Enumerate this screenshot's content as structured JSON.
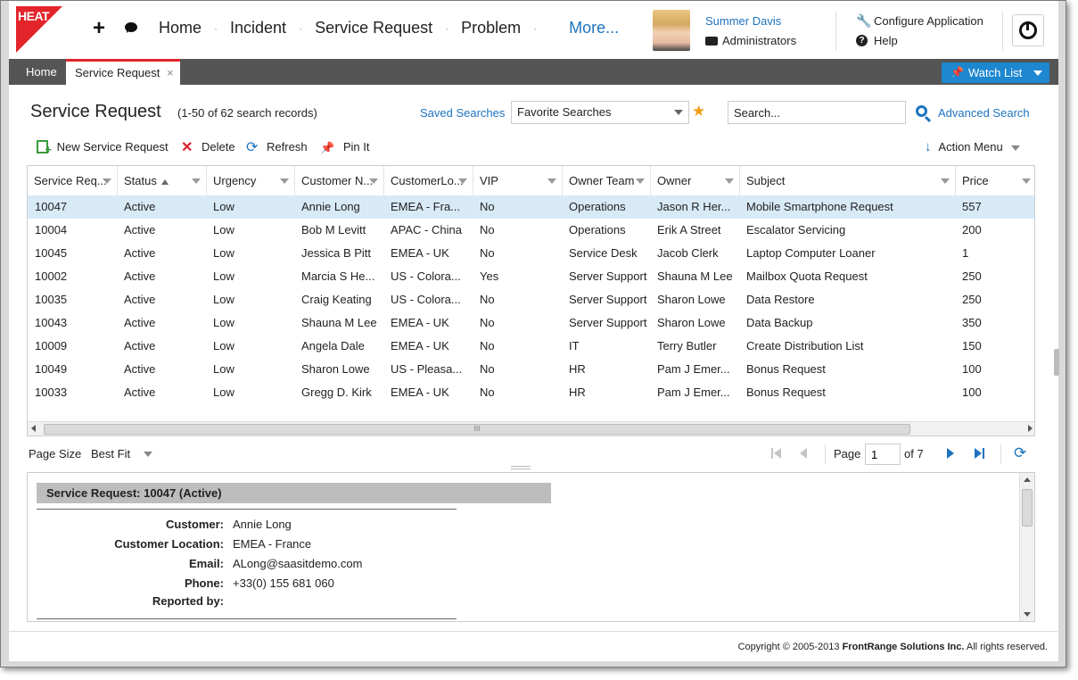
{
  "header": {
    "logo_text": "HEAT",
    "nav": [
      {
        "label": "Home"
      },
      {
        "label": "Incident"
      },
      {
        "label": "Service Request"
      },
      {
        "label": "Problem"
      }
    ],
    "more_label": "More...",
    "user_name": "Summer Davis",
    "user_role": "Administrators",
    "configure_label": "Configure Application",
    "help_label": "Help",
    "icons": [
      "plus-icon",
      "chat-icon",
      "wrench-icon",
      "help-icon",
      "power-icon"
    ]
  },
  "tabs": {
    "home_label": "Home",
    "active_label": "Service Request",
    "close_glyph": "×",
    "watch_list_label": "Watch List"
  },
  "page": {
    "title": "Service Request",
    "record_count": "(1-50 of 62 search records)",
    "saved_searches_label": "Saved Searches",
    "favorite_searches_value": "Favorite Searches",
    "search_placeholder": "Search...",
    "advanced_search_label": "Advanced Search"
  },
  "toolbar": {
    "new_label": "New Service Request",
    "delete_label": "Delete",
    "refresh_label": "Refresh",
    "pin_label": "Pin It",
    "action_menu_label": "Action Menu"
  },
  "grid": {
    "columns": [
      {
        "label": "Service Req..."
      },
      {
        "label": "Status"
      },
      {
        "label": "Urgency"
      },
      {
        "label": "Customer N..."
      },
      {
        "label": "CustomerLo..."
      },
      {
        "label": "VIP"
      },
      {
        "label": "Owner Team"
      },
      {
        "label": "Owner"
      },
      {
        "label": "Subject"
      },
      {
        "label": "Price"
      }
    ],
    "rows": [
      {
        "cells": [
          "10047",
          "Active",
          "Low",
          "Annie Long",
          "EMEA - Fra...",
          "No",
          "Operations",
          "Jason R Her...",
          "Mobile Smartphone Request",
          "557"
        ]
      },
      {
        "cells": [
          "10004",
          "Active",
          "Low",
          "Bob M Levitt",
          "APAC - China",
          "No",
          "Operations",
          "Erik A Street",
          "Escalator Servicing",
          "200"
        ]
      },
      {
        "cells": [
          "10045",
          "Active",
          "Low",
          "Jessica B Pitt",
          "EMEA - UK",
          "No",
          "Service Desk",
          "Jacob Clerk",
          "Laptop Computer Loaner",
          "1"
        ]
      },
      {
        "cells": [
          "10002",
          "Active",
          "Low",
          "Marcia S He...",
          "US - Colora...",
          "Yes",
          "Server Support",
          "Shauna M Lee",
          "Mailbox Quota Request",
          "250"
        ]
      },
      {
        "cells": [
          "10035",
          "Active",
          "Low",
          "Craig Keating",
          "US - Colora...",
          "No",
          "Server Support",
          "Sharon Lowe",
          "Data Restore",
          "250"
        ]
      },
      {
        "cells": [
          "10043",
          "Active",
          "Low",
          "Shauna M Lee",
          "EMEA - UK",
          "No",
          "Server Support",
          "Sharon Lowe",
          "Data Backup",
          "350"
        ]
      },
      {
        "cells": [
          "10009",
          "Active",
          "Low",
          "Angela Dale",
          "EMEA - UK",
          "No",
          "IT",
          "Terry Butler",
          "Create Distribution List",
          "150"
        ]
      },
      {
        "cells": [
          "10049",
          "Active",
          "Low",
          "Sharon Lowe",
          "US - Pleasa...",
          "No",
          "HR",
          "Pam J Emer...",
          "Bonus Request",
          "100"
        ]
      },
      {
        "cells": [
          "10033",
          "Active",
          "Low",
          "Gregg D. Kirk",
          "EMEA - UK",
          "No",
          "HR",
          "Pam J Emer...",
          "Bonus Request",
          "100"
        ]
      }
    ],
    "scroll_grip": "III"
  },
  "pager": {
    "page_size_label": "Page Size",
    "page_size_value": "Best Fit",
    "page_label": "Page",
    "page_value": "1",
    "of_label": "of 7"
  },
  "detail": {
    "title": "Service Request: 10047 (Active)",
    "fields": [
      {
        "label": "Customer:",
        "value": "Annie  Long"
      },
      {
        "label": "Customer Location:",
        "value": "EMEA - France"
      },
      {
        "label": "Email:",
        "value": "ALong@saasitdemo.com"
      },
      {
        "label": "Phone:",
        "value": "+33(0) 155 681 060"
      },
      {
        "label": "Reported by:",
        "value": ""
      }
    ]
  },
  "footer": {
    "copyright_prefix": "Copyright © 2005-2013 ",
    "copyright_company": "FrontRange Solutions Inc.",
    "copyright_suffix": " All rights reserved."
  },
  "colors": {
    "accent_red": "#e3242b",
    "link_blue": "#1e73be",
    "tabbar_gray": "#555555",
    "selected_row": "#d9eaf7",
    "watch_button": "#1d87d0"
  }
}
